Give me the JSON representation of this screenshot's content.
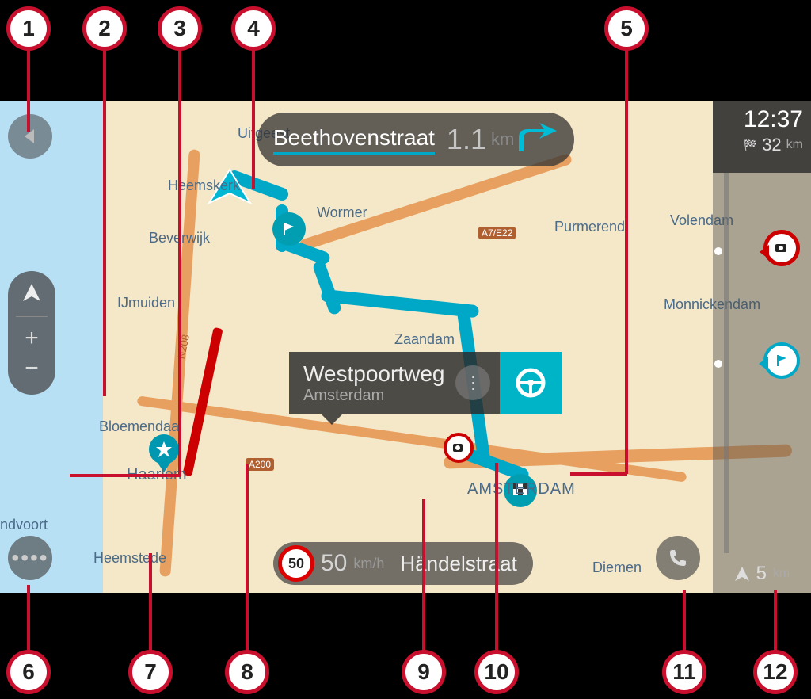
{
  "instruction": {
    "street": "Beethovenstraat",
    "distance_value": "1.1",
    "distance_unit": "km"
  },
  "popup": {
    "title": "Westpoortweg",
    "subtitle": "Amsterdam"
  },
  "speed": {
    "limit": "50",
    "current": "50",
    "unit": "km/h",
    "street": "Händelstraat"
  },
  "route_bar": {
    "arrival_time": "12:37",
    "remaining_distance_value": "32",
    "remaining_distance_unit": "km",
    "nearest_value": "5",
    "nearest_unit": "km"
  },
  "map_labels": {
    "uitgeest": "Uitgeest",
    "heemskerk": "Heemskerk",
    "beverwijk": "Beverwijk",
    "ijmuiden": "IJmuiden",
    "bloemendaal": "Bloemendaal",
    "haarlem": "Haarlem",
    "heemstede": "Heemstede",
    "ndvoort": "ndvoort",
    "wormer": "Wormer",
    "zaandam": "Zaandam",
    "amsterdam": "AMSTERDAM",
    "diemen": "Diemen",
    "purmerend": "Purmerend",
    "volendam": "Volendam",
    "monnickendam": "Monnickendam",
    "n208": "N208",
    "a200": "A200",
    "a7e22": "A7/E22"
  },
  "callouts": {
    "c1": "1",
    "c2": "2",
    "c3": "3",
    "c4": "4",
    "c5": "5",
    "c6": "6",
    "c7": "7",
    "c8": "8",
    "c9": "9",
    "c10": "10",
    "c11": "11",
    "c12": "12"
  }
}
